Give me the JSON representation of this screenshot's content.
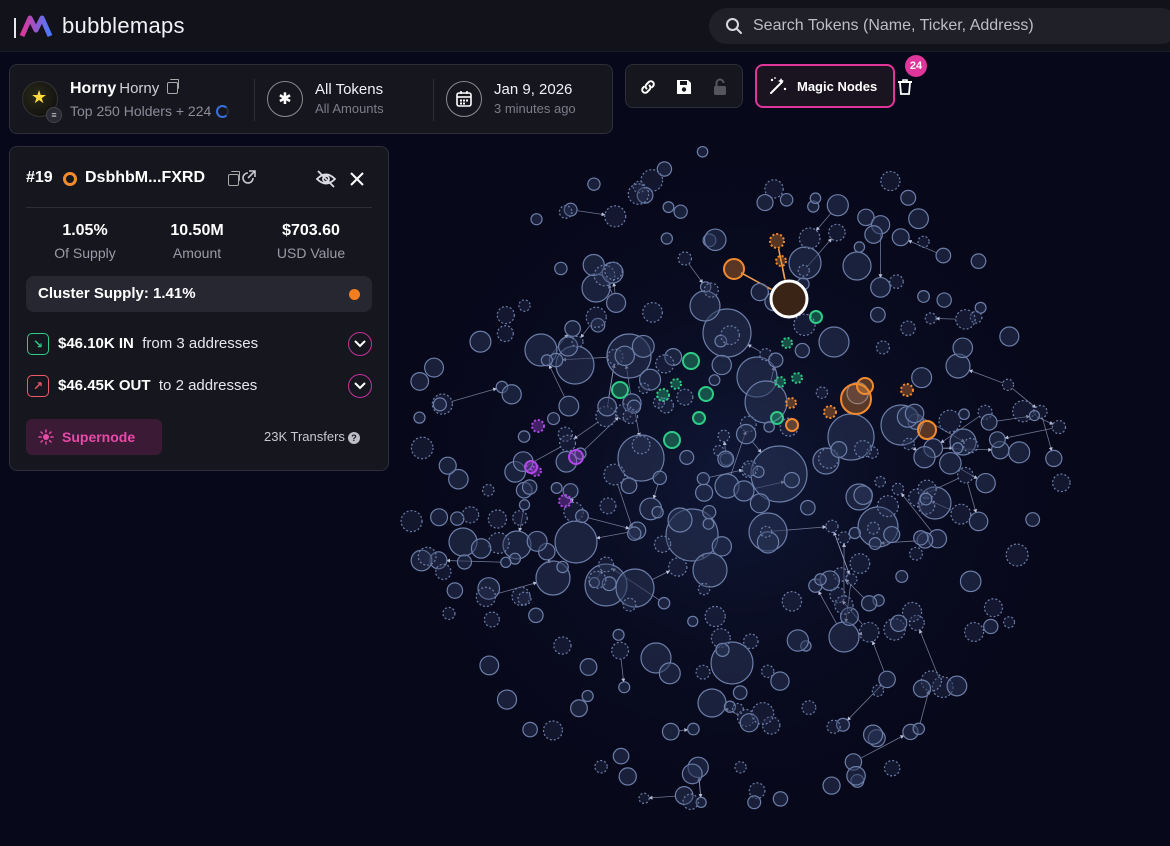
{
  "app": {
    "name": "bubblemaps"
  },
  "search": {
    "placeholder": "Search Tokens (Name, Ticker, Address)"
  },
  "token": {
    "name": "Horny",
    "ticker": "Horny",
    "holders_label": "Top 250 Holders + 224",
    "chain_badge": "≡",
    "filter_title": "All Tokens",
    "filter_sub": "All Amounts",
    "date_title": "Jan 9, 2026",
    "date_sub": "3 minutes ago"
  },
  "toolbar": {
    "magic_label": "Magic Nodes",
    "magic_count": "24"
  },
  "address": {
    "rank": "#19",
    "name": "DsbhbM...FXRD",
    "stats": [
      {
        "value": "1.05%",
        "label": "Of Supply"
      },
      {
        "value": "10.50M",
        "label": "Amount"
      },
      {
        "value": "$703.60",
        "label": "USD Value"
      }
    ],
    "cluster_supply": "Cluster Supply: 1.41%",
    "inflow": {
      "amount": "$46.10K IN",
      "detail": "from 3 addresses"
    },
    "outflow": {
      "amount": "$46.45K OUT",
      "detail": "to 2 addresses"
    },
    "supernode_label": "Supernode",
    "transfers": "23K Transfers"
  },
  "colors": {
    "accent_pink": "#e0359a",
    "cluster_orange": "#f28a2e",
    "cluster_green": "#2ecc87",
    "cluster_purple": "#b048e8",
    "bubble_fill": "#2a3556",
    "bubble_stroke": "#6c7ea8"
  },
  "icons": [
    "search-icon",
    "copy-icon",
    "asterisk-icon",
    "calendar-icon",
    "link-icon",
    "save-icon",
    "lock-icon",
    "magic-wand-icon",
    "trash-icon",
    "hide-icon",
    "close-icon",
    "external-link-icon",
    "inflow-icon",
    "outflow-icon",
    "chevron-down-icon",
    "sun-icon",
    "help-icon"
  ]
}
